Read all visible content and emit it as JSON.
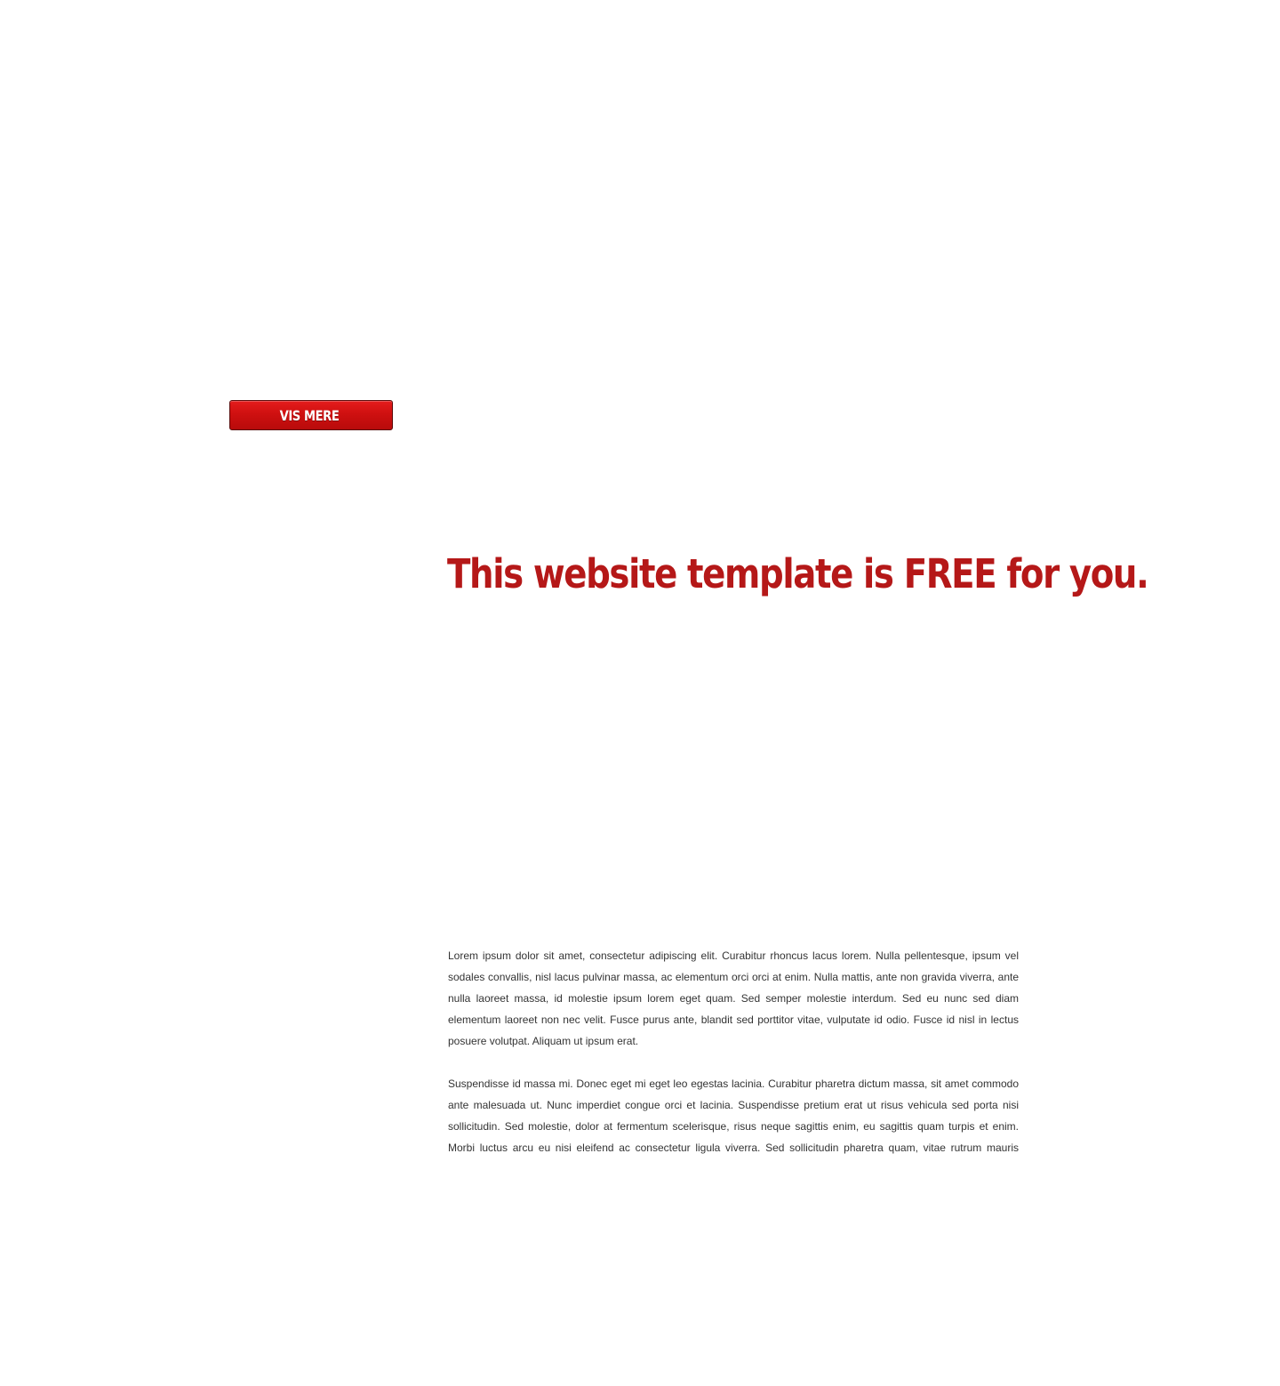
{
  "button": {
    "label": "VIS MERE"
  },
  "headline": "This website template is FREE for you.",
  "article": {
    "paragraphs": [
      "Lorem ipsum dolor sit amet, consectetur adipiscing elit. Curabitur rhoncus lacus lorem. Nulla pellentesque, ipsum vel sodales convallis, nisl lacus pulvinar massa, ac elementum orci orci at enim. Nulla mattis, ante non gravida viverra, ante nulla laoreet massa, id molestie ipsum lorem eget quam. Sed semper molestie interdum. Sed eu nunc sed diam elementum laoreet non nec velit. Fusce purus ante, blandit sed porttitor vitae, vulputate id odio. Fusce id nisl in lectus posuere volutpat. Aliquam ut ipsum erat.",
      "Suspendisse id massa mi. Donec eget mi eget leo egestas lacinia. Curabitur pharetra dictum massa, sit amet commodo ante malesuada ut. Nunc imperdiet congue orci et lacinia. Suspendisse pretium erat ut risus vehicula sed porta nisi sollicitudin. Sed molestie, dolor at fermentum scelerisque, risus neque sagittis enim, eu sagittis quam turpis et enim. Morbi luctus arcu eu nisi eleifend ac consectetur ligula viverra. Sed sollicitudin pharetra quam, vitae rutrum mauris dignissim"
    ]
  },
  "colors": {
    "accent": "#b51818",
    "button_red": "#cf1010",
    "body_text": "#333333",
    "background": "#ffffff"
  }
}
